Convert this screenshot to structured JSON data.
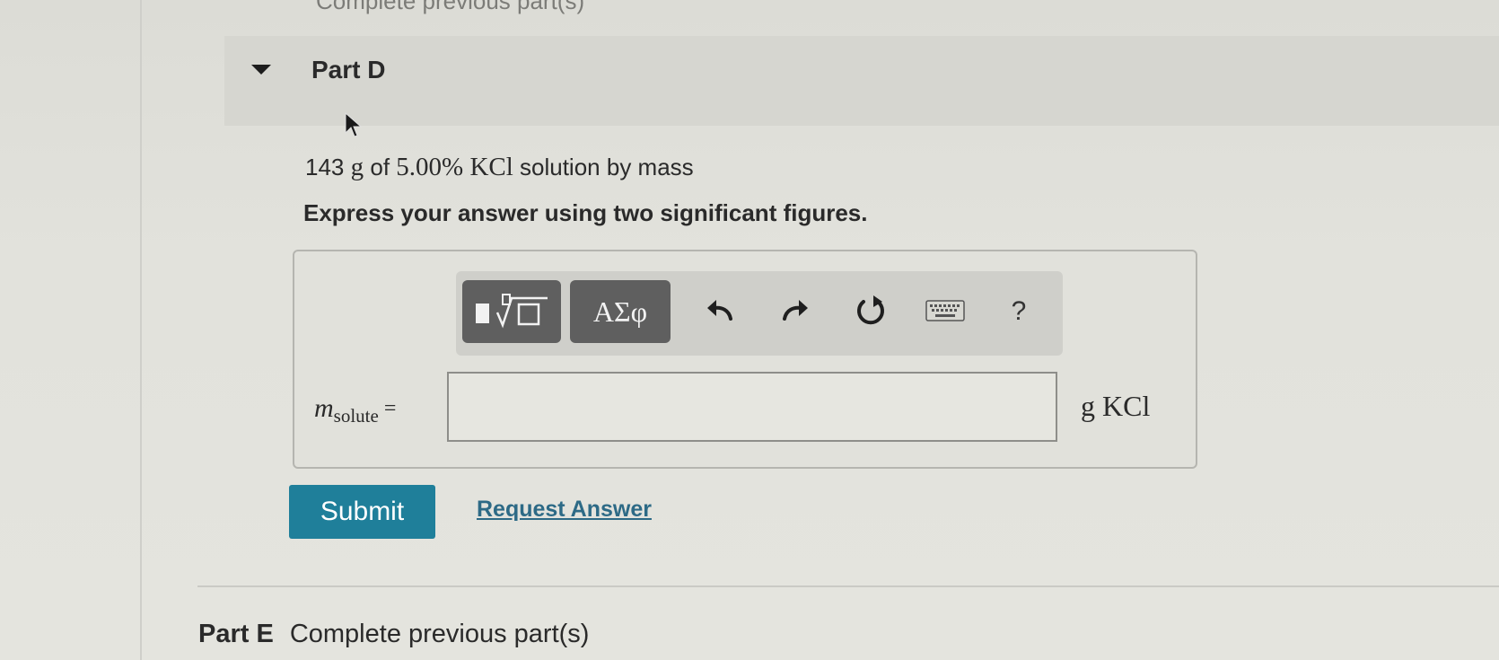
{
  "top_cutoff_text": "Complete previous part(s)",
  "part_d": {
    "title": "Part D",
    "problem": {
      "mass": "143",
      "mass_unit": "g",
      "of_text": "of",
      "percent": "5.00%",
      "compound": "KCl",
      "tail": "solution by mass"
    },
    "instruction": "Express your answer using two significant figures."
  },
  "toolbar": {
    "greek_label": "ΑΣφ",
    "help_label": "?",
    "icons": [
      "templates-icon",
      "undo-icon",
      "redo-icon",
      "reset-icon",
      "keyboard-icon",
      "help-icon"
    ]
  },
  "answer": {
    "variable": "m",
    "subscript": "solute",
    "equals": "=",
    "value": "",
    "unit": "g KCl"
  },
  "actions": {
    "submit_label": "Submit",
    "request_label": "Request Answer"
  },
  "part_e": {
    "label": "Part E",
    "status": "Complete previous part(s)"
  },
  "colors": {
    "submit_bg": "#1f7f9a",
    "link": "#2d6a86",
    "toolbar_button": "#5f5f5f"
  }
}
